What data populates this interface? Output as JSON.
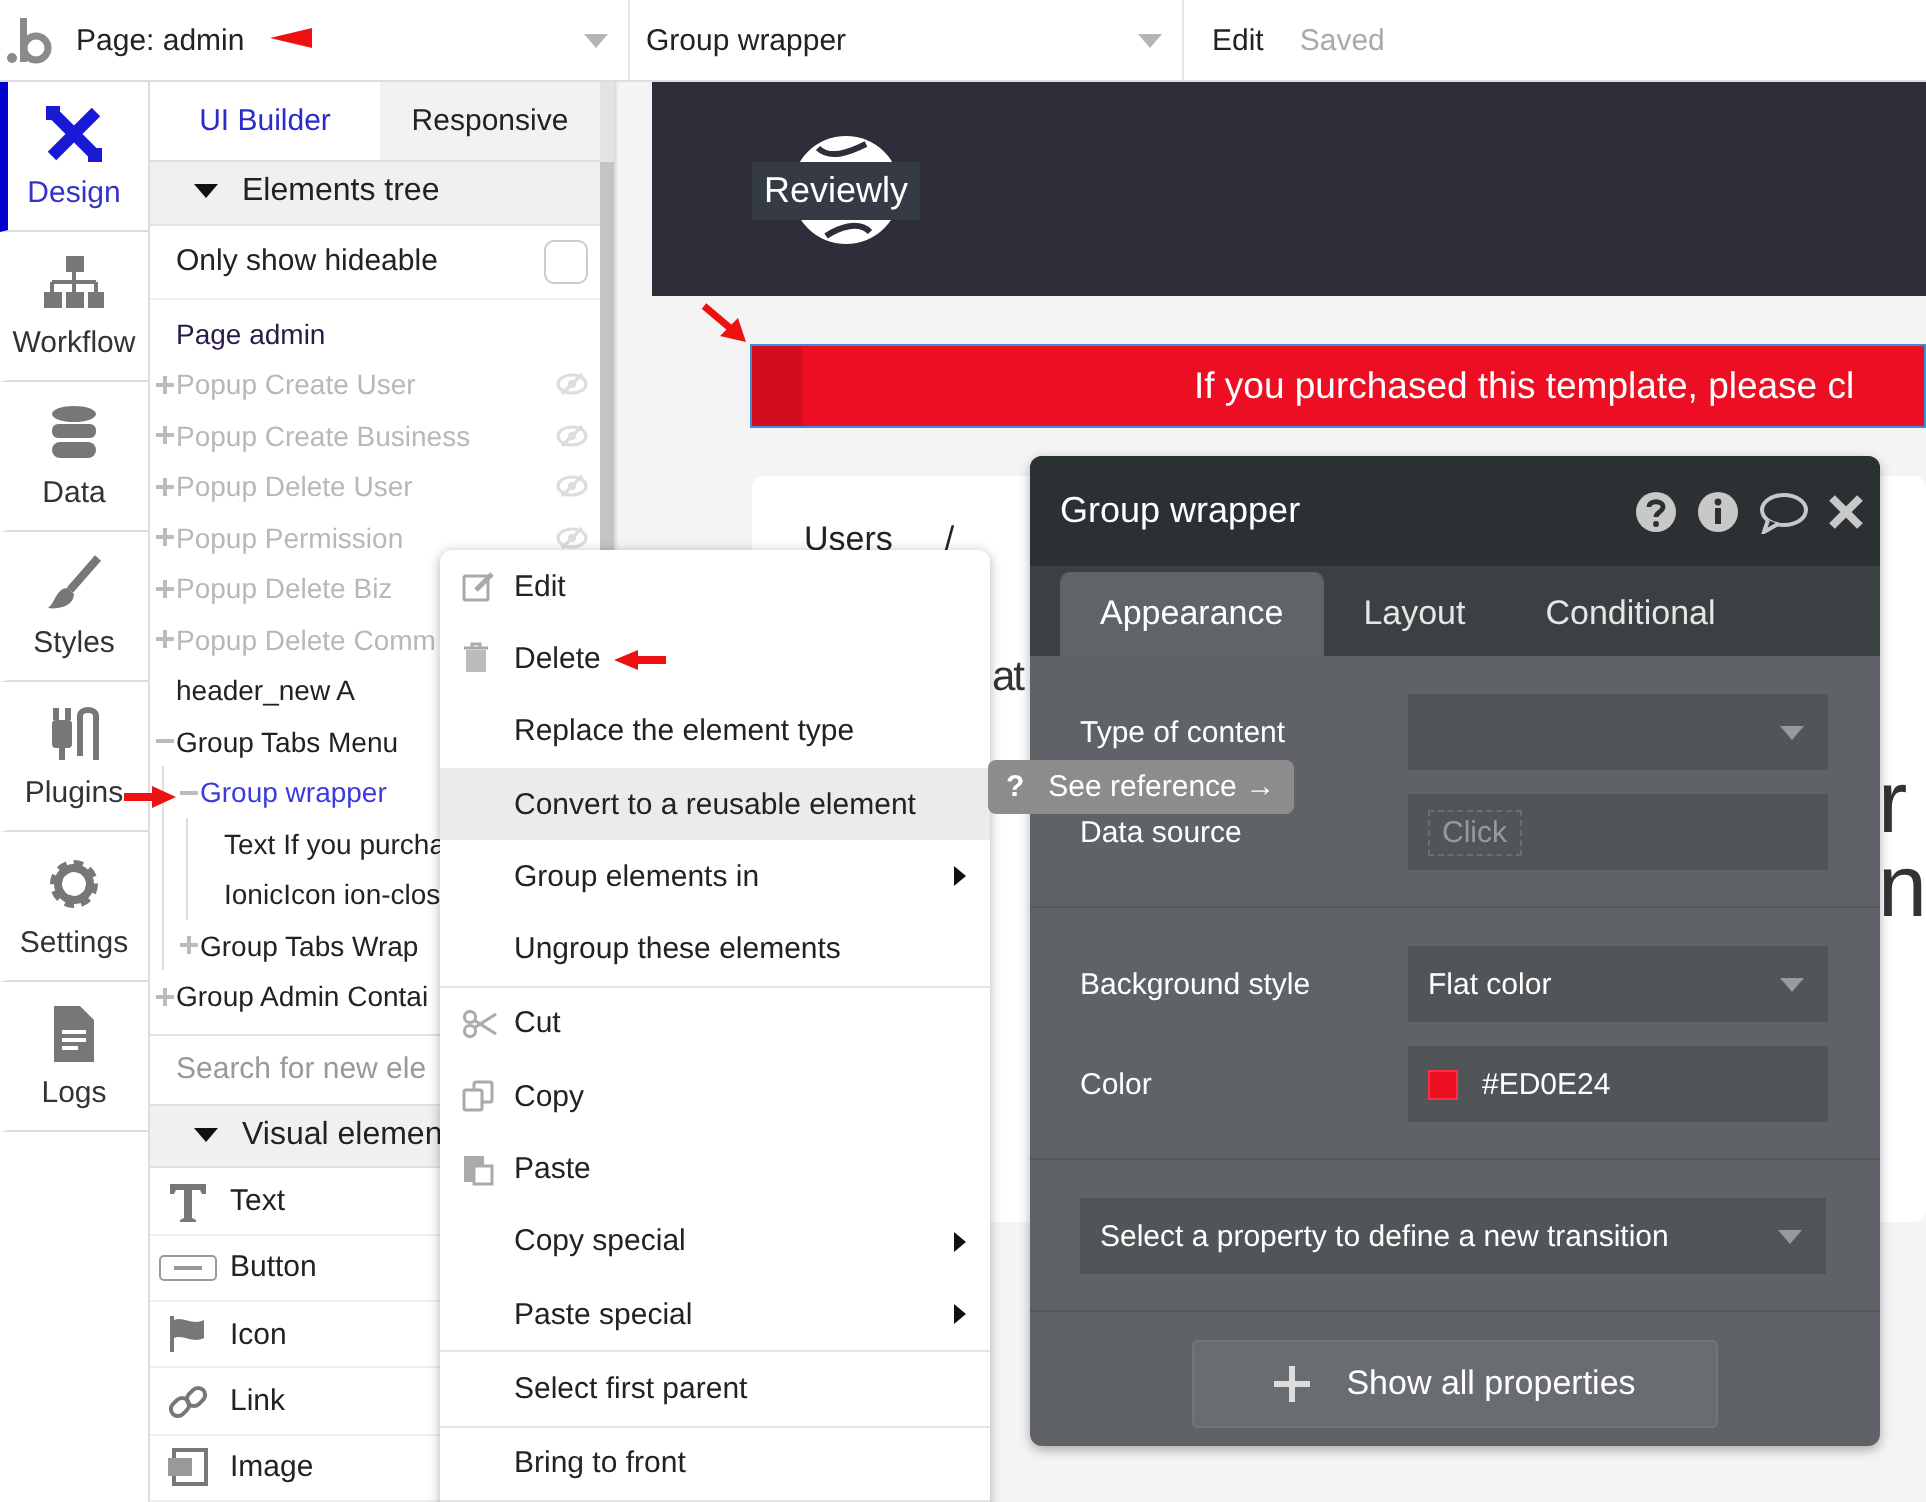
{
  "topbar": {
    "page_selector": {
      "label": "Page: admin"
    },
    "element_selector": {
      "label": "Group wrapper"
    },
    "edit_label": "Edit",
    "save_status": "Saved"
  },
  "sidebar": {
    "items": [
      {
        "label": "Design",
        "kind": "design",
        "selected": true
      },
      {
        "label": "Workflow",
        "kind": "workflow",
        "selected": false
      },
      {
        "label": "Data",
        "kind": "data",
        "selected": false
      },
      {
        "label": "Styles",
        "kind": "styles",
        "selected": false
      },
      {
        "label": "Plugins",
        "kind": "plugins",
        "selected": false
      },
      {
        "label": "Settings",
        "kind": "settings",
        "selected": false
      },
      {
        "label": "Logs",
        "kind": "logs",
        "selected": false
      }
    ]
  },
  "panel": {
    "tabs": [
      {
        "label": "UI Builder",
        "selected": true
      },
      {
        "label": "Responsive",
        "selected": false
      }
    ],
    "elements_tree": {
      "title": "Elements tree",
      "expanded": true,
      "filter": {
        "label": "Only show hideable",
        "checked": false
      },
      "nodes": [
        {
          "label": "Page admin",
          "kind": "page",
          "hidden": false,
          "selected": false
        },
        {
          "label": "Popup Create User",
          "hidden": true,
          "expanded": false,
          "selected": false
        },
        {
          "label": "Popup Create Business",
          "hidden": true,
          "expanded": false,
          "selected": false
        },
        {
          "label": "Popup Delete User",
          "hidden": true,
          "expanded": false,
          "selected": false
        },
        {
          "label": "Popup Permission",
          "hidden": true,
          "expanded": false,
          "selected": false
        },
        {
          "label": "Popup Delete Biz",
          "hidden": true,
          "expanded": false,
          "selected": false
        },
        {
          "label": "Popup Delete Comm",
          "hidden": true,
          "expanded": false,
          "selected": false
        },
        {
          "label": "header_new A",
          "hidden": false,
          "selected": false
        },
        {
          "label": "Group Tabs Menu",
          "hidden": false,
          "expanded": true,
          "selected": false,
          "children": [
            {
              "label": "Group wrapper",
              "hidden": false,
              "expanded": true,
              "selected": true,
              "children": [
                {
                  "label": "Text If you purcha",
                  "hidden": false,
                  "selected": false
                },
                {
                  "label": "IonicIcon ion-clos",
                  "hidden": false,
                  "selected": false
                }
              ]
            },
            {
              "label": "Group Tabs Wrap",
              "hidden": false,
              "expanded": false,
              "selected": false
            }
          ]
        },
        {
          "label": "Group Admin Contai",
          "hidden": false,
          "expanded": false,
          "selected": false
        }
      ]
    },
    "search": {
      "placeholder": "Search for new ele"
    },
    "visual_elements": {
      "title": "Visual elemen",
      "expanded": true,
      "items": [
        {
          "label": "Text",
          "kind": "text"
        },
        {
          "label": "Button",
          "kind": "button"
        },
        {
          "label": "Icon",
          "kind": "icon"
        },
        {
          "label": "Link",
          "kind": "link"
        },
        {
          "label": "Image",
          "kind": "image"
        }
      ]
    }
  },
  "canvas": {
    "logo_label": "Reviewly",
    "banner": {
      "text": "If you purchased this template, please cl",
      "color": "#ed0e24",
      "selected": true
    },
    "card": {
      "breadcrumb": [
        "Users",
        "/"
      ],
      "fragments": [
        "at",
        "r",
        "n"
      ]
    }
  },
  "context_menu": {
    "groups": [
      [
        {
          "label": "Edit",
          "kind": "edit",
          "submenu": false,
          "selected": false
        },
        {
          "label": "Delete",
          "kind": "delete",
          "submenu": false,
          "selected": false
        },
        {
          "label": "Replace the element type",
          "kind": "plain",
          "submenu": false,
          "selected": false
        },
        {
          "label": "Convert to a reusable element",
          "kind": "plain",
          "submenu": false,
          "selected": true
        },
        {
          "label": "Group elements in",
          "kind": "plain",
          "submenu": true,
          "selected": false
        },
        {
          "label": "Ungroup these elements",
          "kind": "plain",
          "submenu": false,
          "selected": false
        }
      ],
      [
        {
          "label": "Cut",
          "kind": "cut",
          "submenu": false,
          "selected": false
        },
        {
          "label": "Copy",
          "kind": "copy",
          "submenu": false,
          "selected": false
        },
        {
          "label": "Paste",
          "kind": "paste",
          "submenu": false,
          "selected": false
        },
        {
          "label": "Copy special",
          "kind": "plain",
          "submenu": true,
          "selected": false
        },
        {
          "label": "Paste special",
          "kind": "plain",
          "submenu": true,
          "selected": false
        }
      ],
      [
        {
          "label": "Select first parent",
          "kind": "plain",
          "submenu": false,
          "selected": false
        }
      ],
      [
        {
          "label": "Bring to front",
          "kind": "plain",
          "submenu": false,
          "selected": false
        }
      ]
    ]
  },
  "tooltip": {
    "icon": "?",
    "label": "See reference →"
  },
  "property_editor": {
    "title": "Group wrapper",
    "tabs": [
      {
        "label": "Appearance",
        "selected": true
      },
      {
        "label": "Layout",
        "selected": false
      },
      {
        "label": "Conditional",
        "selected": false
      }
    ],
    "sections": [
      {
        "rows": [
          {
            "kind": "dropdown",
            "label": "Type of content"
          },
          {
            "kind": "dynamic",
            "label": "Data source",
            "placeholder": "Click"
          }
        ]
      },
      {
        "rows": [
          {
            "kind": "dropdown",
            "label": "Background style",
            "value": "Flat color"
          },
          {
            "kind": "color",
            "label": "Color",
            "value": "#ED0E24",
            "color": "#ed0e24"
          }
        ]
      },
      {
        "rows": [
          {
            "kind": "dropdown",
            "value": "Select a property to define a new transition"
          }
        ]
      }
    ],
    "button": "Show all properties"
  }
}
